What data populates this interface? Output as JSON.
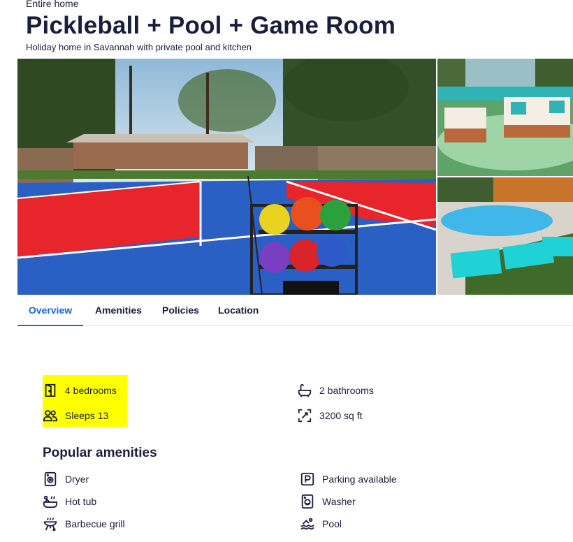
{
  "header": {
    "property_type": "Entire home",
    "title": "Pickleball + Pool + Game Room",
    "subtitle": "Holiday home in Savannah with private pool and kitchen"
  },
  "tabs": [
    {
      "label": "Overview",
      "active": true
    },
    {
      "label": "Amenities",
      "active": false
    },
    {
      "label": "Policies",
      "active": false
    },
    {
      "label": "Location",
      "active": false
    }
  ],
  "key_facts": [
    {
      "icon": "door-icon",
      "label": "4 bedrooms"
    },
    {
      "icon": "bathtub-icon",
      "label": "2 bathrooms"
    },
    {
      "icon": "people-icon",
      "label": "Sleeps 13"
    },
    {
      "icon": "expand-icon",
      "label": "3200 sq ft"
    }
  ],
  "popular_amenities": {
    "title": "Popular amenities",
    "items": [
      {
        "icon": "dryer-icon",
        "label": "Dryer"
      },
      {
        "icon": "parking-icon",
        "label": "Parking available"
      },
      {
        "icon": "hot-tub-icon",
        "label": "Hot tub"
      },
      {
        "icon": "washer-icon",
        "label": "Washer"
      },
      {
        "icon": "grill-icon",
        "label": "Barbecue grill"
      },
      {
        "icon": "pool-icon",
        "label": "Pool"
      }
    ]
  },
  "colors": {
    "accent": "#1668e3",
    "text": "#191e3b",
    "highlight": "#ffff00"
  }
}
